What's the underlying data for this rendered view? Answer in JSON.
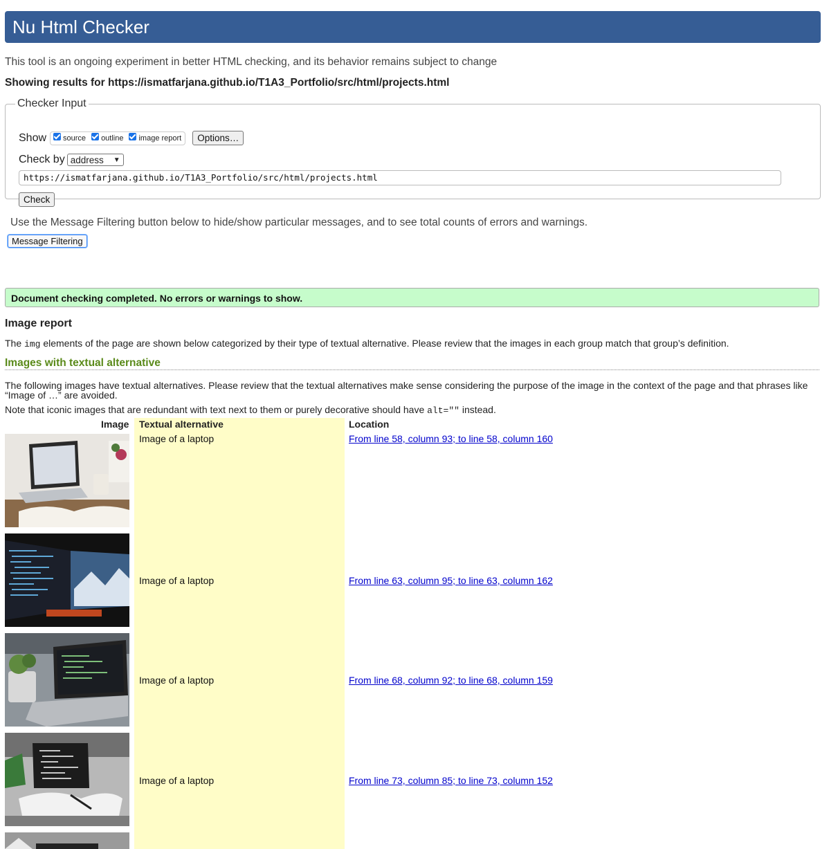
{
  "header": {
    "title": "Nu Html Checker"
  },
  "intro": "This tool is an ongoing experiment in better HTML checking, and its behavior remains subject to change",
  "showing": {
    "prefix": "Showing results for",
    "url": "https://ismatfarjana.github.io/T1A3_Portfolio/src/html/projects.html"
  },
  "checker_input": {
    "legend": "Checker Input",
    "show_label": "Show",
    "options": [
      {
        "label": "source",
        "checked": true
      },
      {
        "label": "outline",
        "checked": true
      },
      {
        "label": "image report",
        "checked": true
      }
    ],
    "options_button": "Options…",
    "check_by_label": "Check by",
    "check_by_value": "address",
    "url_value": "https://ismatfarjana.github.io/T1A3_Portfolio/src/html/projects.html",
    "check_button": "Check"
  },
  "filtering": {
    "text": "Use the Message Filtering button below to hide/show particular messages, and to see total counts of errors and warnings.",
    "button": "Message Filtering"
  },
  "result_message": "Document checking completed. No errors or warnings to show.",
  "image_report": {
    "title": "Image report",
    "desc_prefix": "The",
    "desc_code": "img",
    "desc_suffix": "elements of the page are shown below categorized by their type of textual alternative. Please review that the images in each group match that group’s definition.",
    "section_title": "Images with textual alternative",
    "following": "The following images have textual alternatives. Please review that the textual alternatives make sense considering the purpose of the image in the context of the page and that phrases like “Image of …” are avoided.",
    "note_prefix": "Note that iconic images that are redundant with text next to them or purely decorative should have",
    "note_code": "alt=\"\"",
    "note_suffix": "instead.",
    "headers": {
      "image": "Image",
      "alt": "Textual alternative",
      "location": "Location"
    },
    "rows": [
      {
        "alt": "Image of a laptop",
        "location": "From line 58, column 93; to line 58, column 160"
      },
      {
        "alt": "Image of a laptop",
        "location": "From line 63, column 95; to line 63, column 162"
      },
      {
        "alt": "Image of a laptop",
        "location": "From line 68, column 92; to line 68, column 159"
      },
      {
        "alt": "Image of a laptop",
        "location": "From line 73, column 85; to line 73, column 152"
      }
    ]
  }
}
